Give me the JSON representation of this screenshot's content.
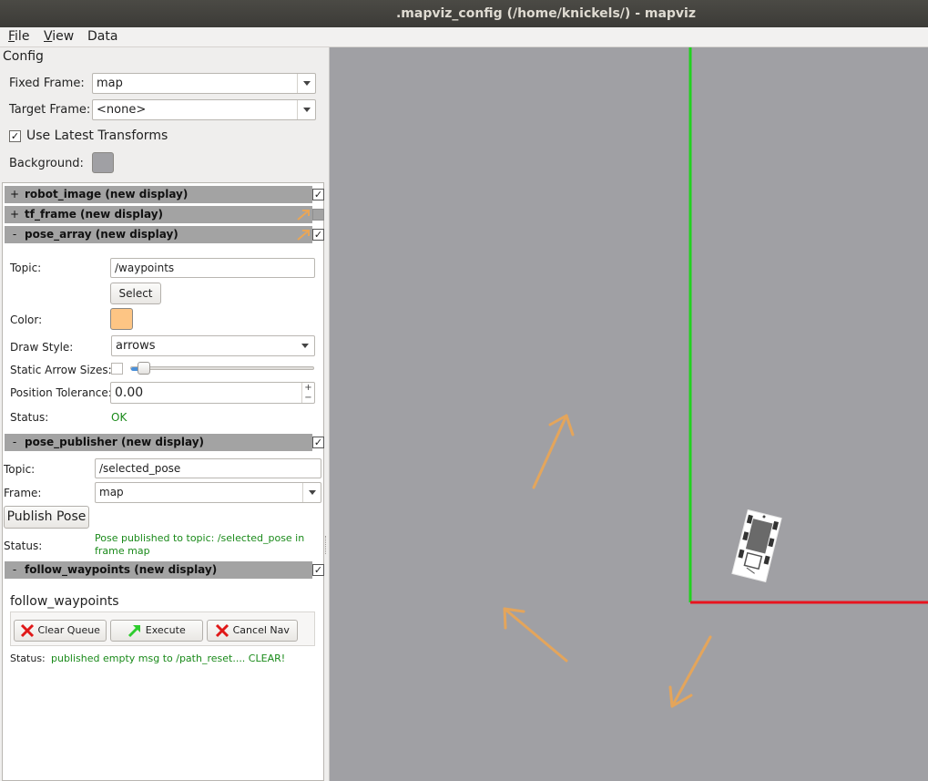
{
  "window": {
    "title": ".mapviz_config (/home/knickels/) - mapviz"
  },
  "menu": {
    "file_label": "File",
    "view_label": "View",
    "data_label": "Data"
  },
  "config": {
    "heading": "Config",
    "fixed_frame_label": "Fixed Frame:",
    "fixed_frame_value": "map",
    "target_frame_label": "Target Frame:",
    "target_frame_value": "<none>",
    "use_latest_transforms_label": "Use Latest Transforms",
    "use_latest_transforms_checked": "✓",
    "background_label": "Background:",
    "background_color": "#a0a0a4"
  },
  "displays": {
    "robot_image": {
      "sign": "+",
      "name": "robot_image (new display)",
      "checked": "✓"
    },
    "tf_frame": {
      "sign": "+",
      "name": "tf_frame (new display)",
      "checked": ""
    },
    "pose_array": {
      "sign": "-",
      "name": "pose_array (new display)",
      "checked": "✓"
    },
    "pose_publisher": {
      "sign": "-",
      "name": "pose_publisher (new display)",
      "checked": "✓"
    },
    "follow_waypoints": {
      "sign": "-",
      "name": "follow_waypoints (new display)",
      "checked": "✓"
    }
  },
  "pose_array": {
    "topic_label": "Topic:",
    "topic_value": "/waypoints",
    "select_label": "Select",
    "color_label": "Color:",
    "color": "#fdc584",
    "draw_style_label": "Draw Style:",
    "draw_style_value": "arrows",
    "static_arrow_label": "Static Arrow Sizes:",
    "arrow_size_level": 0.06,
    "position_tolerance_label": "Position Tolerance:",
    "position_tolerance_value": "0.00",
    "status_label": "Status:",
    "status_value": "OK"
  },
  "pose_publisher": {
    "topic_label": "Topic:",
    "topic_value": "/selected_pose",
    "frame_label": "Frame:",
    "frame_value": "map",
    "publish_label": "Publish Pose",
    "status_label": "Status:",
    "status_line1": "Pose published to topic: /selected_pose in",
    "status_line2": "frame map"
  },
  "follow_waypoints": {
    "title": "follow_waypoints",
    "clear_queue_label": "Clear Queue",
    "execute_label": "Execute",
    "cancel_nav_label": "Cancel Nav",
    "status_label": "Status:",
    "status_value": "published empty msg to /path_reset.... CLEAR!"
  },
  "icons": {
    "clear": "red-x-icon",
    "execute": "green-arrow-icon",
    "cancel": "red-x-icon",
    "spin_up": "+",
    "spin_down": "−"
  },
  "colors": {
    "x_axis": "#e8141e",
    "y_axis": "#22d11f",
    "arrow": "#e8a658",
    "canvas": "#a0a0a4"
  }
}
